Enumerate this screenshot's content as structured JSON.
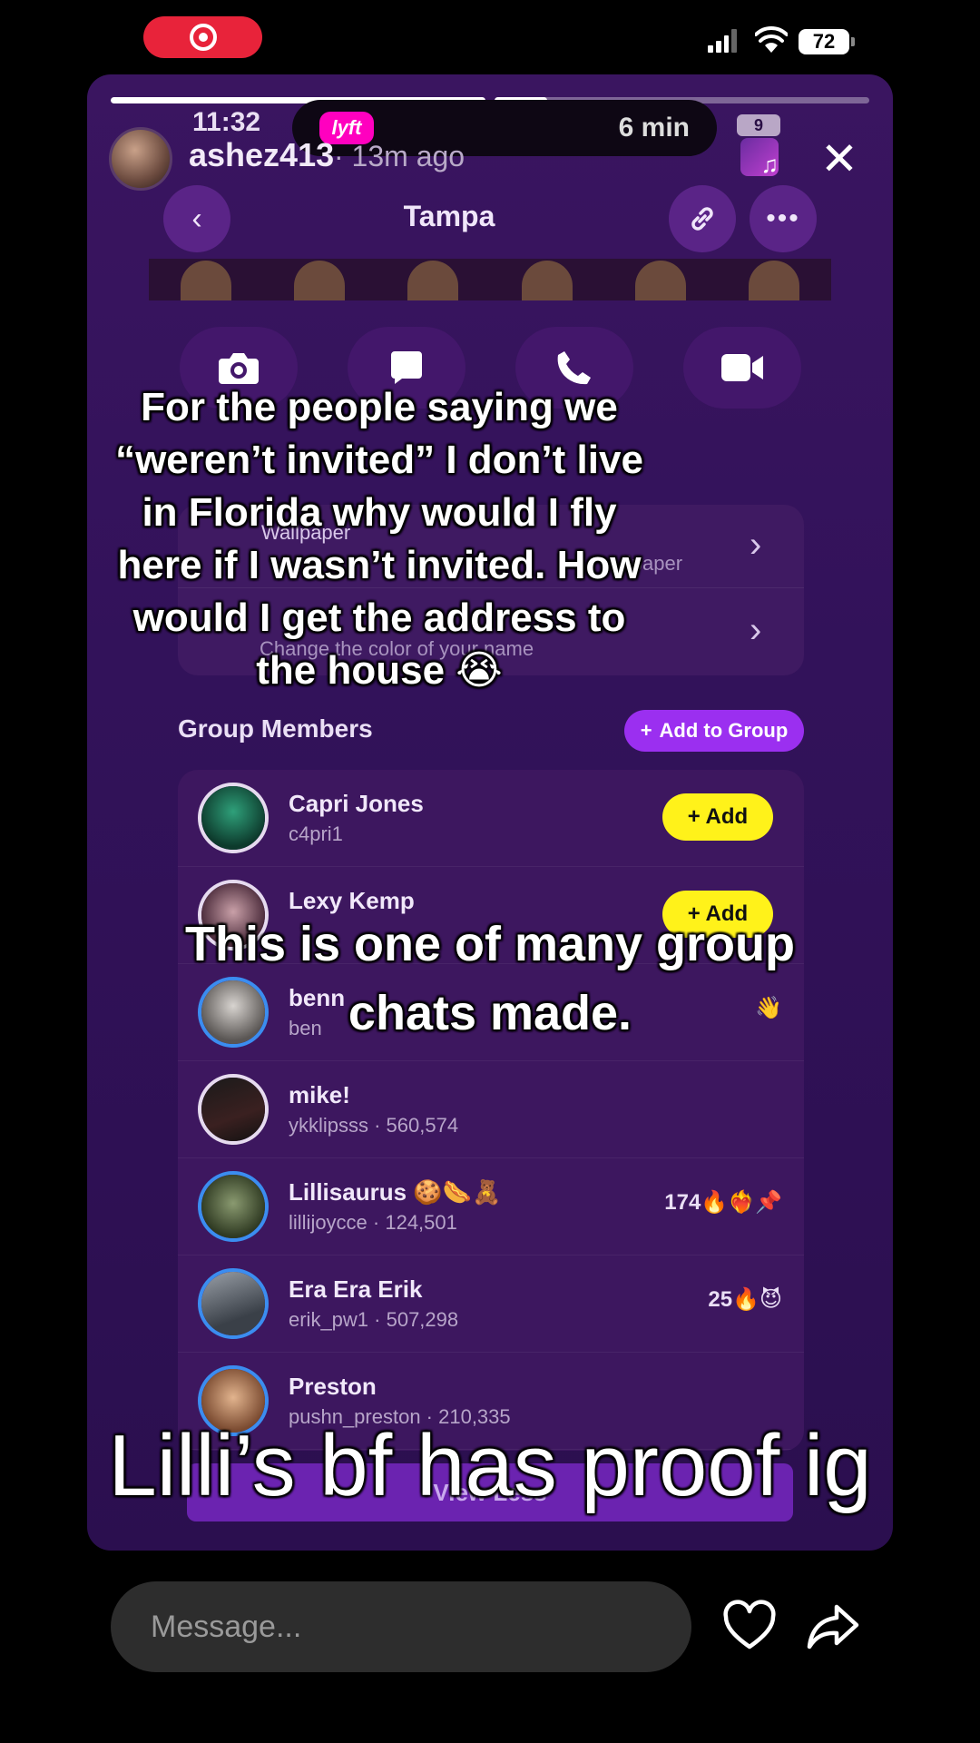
{
  "status_bar": {
    "battery": "72"
  },
  "story": {
    "username": "ashez413",
    "time_ago": "· 13m ago",
    "progress": [
      1.0,
      0.14
    ],
    "inner_time": "11:32",
    "lyft_label": "lyft",
    "lyft_eta": "6 min",
    "inner_battery": "9"
  },
  "snap": {
    "header_title": "Tampa",
    "settings": [
      {
        "title": "Wallpaper",
        "subtitle": "llpaper"
      },
      {
        "title": "",
        "subtitle": "Change the color of your name"
      }
    ],
    "members_title": "Group Members",
    "add_to_group": "Add to Group",
    "members": [
      {
        "name": "Capri Jones",
        "user": "c4pri1",
        "action": "+ Add",
        "ring": "white"
      },
      {
        "name": "Lexy Kemp",
        "user": "",
        "action": "+ Add",
        "ring": "white"
      },
      {
        "name": "benn",
        "user": "ben",
        "action": "👋",
        "ring": "blue"
      },
      {
        "name": "mike!",
        "user": "ykklipsss · 560,574",
        "action": "",
        "ring": "white"
      },
      {
        "name": "Lillisaurus 🍪🌭🧸",
        "user": "lillijoycce · 124,501",
        "action": "174🔥❤️‍🔥📌",
        "ring": "blue"
      },
      {
        "name": "Era Era Erik",
        "user": "erik_pw1 · 507,298",
        "action": "25🔥😈",
        "ring": "blue"
      },
      {
        "name": "Preston",
        "user": "pushn_preston · 210,335",
        "action": "",
        "ring": "blue"
      }
    ],
    "view_less": "View Less"
  },
  "captions": {
    "caption1": "For the people saying we “weren’t invited” I don’t live in Florida why would I fly here if I wasn’t invited. How would I get the address to the house 😭",
    "caption2": "This is one of many group chats made.",
    "caption3": "Lilli’s bf has proof ig"
  },
  "bottom": {
    "message_placeholder": "Message..."
  },
  "colors": {
    "accent_purple": "#9b2ff0",
    "add_yellow": "#fff21a",
    "record_red": "#e8233a"
  }
}
